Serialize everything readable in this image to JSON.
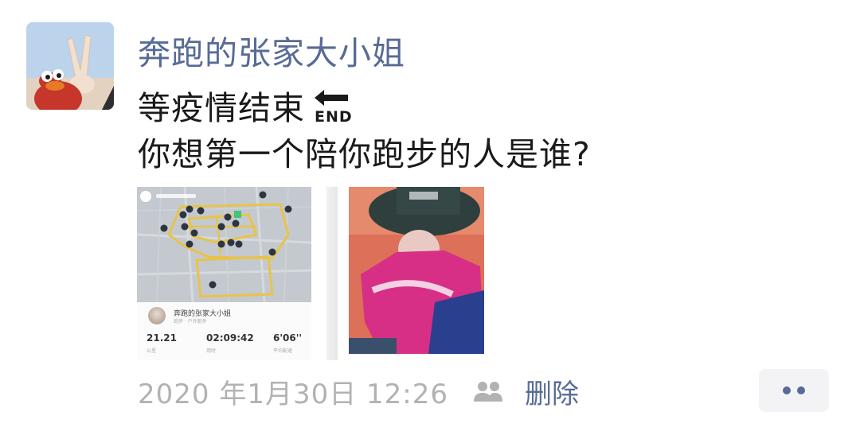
{
  "post": {
    "author_name": "奔跑的张家大小姐",
    "avatar_icon": "avatar-photo",
    "text_line1": "等疫情结束",
    "end_emoji": "END",
    "end_emoji_icon": "end-arrow-icon",
    "text_line2": "你想第一个陪你跑步的人是谁?",
    "images": [
      {
        "kind": "run-map-screenshot",
        "card": {
          "name": "奔跑的张家大小姐",
          "subtitle": "跑步 · 户外跑步",
          "distance": "21.21",
          "distance_label": "公里",
          "duration": "02:09:42",
          "duration_label": "用时",
          "pace": "6'06''",
          "pace_label": "平均配速"
        }
      },
      {
        "kind": "selfie-photo"
      }
    ],
    "timestamp": "2020 年1月30日 12:26",
    "visibility_icon": "friends-icon",
    "delete_label": "删除",
    "more_icon": "more-dots-icon"
  },
  "colors": {
    "name_link": "#576b95",
    "text": "#1a1a1a",
    "meta_gray": "#b2b2b2",
    "route_yellow": "#e8c34a"
  }
}
